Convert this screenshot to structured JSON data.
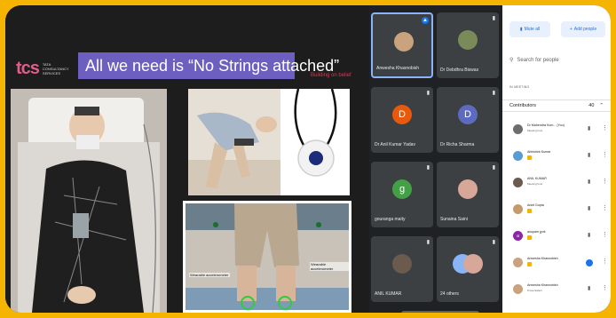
{
  "slide": {
    "logo_mark": "tcs",
    "logo_text": "TATA CONSULTANCY SERVICES",
    "title": "All we need is “No Strings attached”",
    "tag": "Building on belief",
    "photo_d_labels": [
      "Wearable accelerometer",
      "Wearable accelerometer"
    ]
  },
  "participants": [
    {
      "name": "Anwesha Khasnobish",
      "avatar": "",
      "color": "#c9a27e",
      "pinned": true
    },
    {
      "name": "Dr Debdhra Biswas",
      "avatar": "",
      "color": "#7a8a58",
      "pinned": false
    },
    {
      "name": "Dr Anil Kumar Yadav",
      "avatar": "D",
      "color": "#e8590c",
      "pinned": false
    },
    {
      "name": "Dr Richa Sharma",
      "avatar": "D",
      "color": "#5c6bc0",
      "pinned": false
    },
    {
      "name": "gouranga maity",
      "avatar": "g",
      "color": "#43a047",
      "pinned": false
    },
    {
      "name": "Sunaina Saini",
      "avatar": "",
      "color": "#d7a89a",
      "pinned": false
    },
    {
      "name": "ANIL KUMAR",
      "avatar": "",
      "color": "#6b5a4e",
      "pinned": false
    },
    {
      "name": "24 others",
      "avatar": "",
      "color": "#8ab4f8",
      "pinned": false
    }
  ],
  "panel": {
    "mute_all": "Mute all",
    "add_people": "Add people",
    "search_placeholder": "Search for people",
    "section_label": "IN MEETING",
    "contributors_label": "Contributors",
    "contributors_count": "40",
    "people": [
      {
        "name": "Dr Mahendra Kum... (You)",
        "sub": "Meeting host",
        "avatar": "",
        "color": "#6d6d6d"
      },
      {
        "name": "Abhishek Kumar",
        "sub": "",
        "avatar": "",
        "color": "#5a9bd4"
      },
      {
        "name": "ANIL KUMAR",
        "sub": "Meeting host",
        "avatar": "",
        "color": "#6b5a4e"
      },
      {
        "name": "Ankit Gupta",
        "sub": "",
        "avatar": "",
        "color": "#c79a6e"
      },
      {
        "name": "anupam jyoti",
        "sub": "",
        "avatar": "a",
        "color": "#8e24aa"
      },
      {
        "name": "Anwesha Khasnobish",
        "sub": "",
        "avatar": "",
        "color": "#c9a27e"
      },
      {
        "name": "Anwesha Khasnobish",
        "sub": "Presentation",
        "avatar": "",
        "color": "#c9a27e"
      }
    ]
  }
}
